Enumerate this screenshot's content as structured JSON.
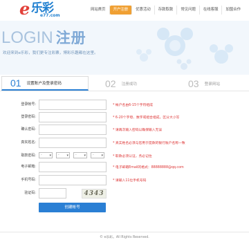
{
  "header": {
    "logo_mark": "e",
    "logo_cn": "乐彩",
    "logo_sub": "e77.com",
    "nav": [
      {
        "label": "网站首页",
        "active": false
      },
      {
        "label": "开户注册",
        "active": true
      },
      {
        "label": "优惠活动",
        "active": false
      },
      {
        "label": "存款取款",
        "active": false
      },
      {
        "label": "常见问题",
        "active": false
      },
      {
        "label": "在线客服",
        "active": false
      },
      {
        "label": "加盟合作",
        "active": false
      }
    ]
  },
  "banner": {
    "title_en": "LOGIN",
    "title_cn": "注册",
    "subtitle": "欢迎来到e乐彩，我们更专注彩票，博彩乐趣都在这里。"
  },
  "steps": [
    {
      "num": "01",
      "label": "设置账户及登录密码",
      "active": true
    },
    {
      "num": "02",
      "label": "注册成功",
      "active": false
    },
    {
      "num": "03",
      "label": "登录网站",
      "active": false
    }
  ],
  "form": {
    "fields": [
      {
        "label": "登录帐号:",
        "hint": "* 帐户名由6-15个字符组成"
      },
      {
        "label": "登录密码:",
        "hint": "* 6-20个字母、数字或组合组成，区分大小写"
      },
      {
        "label": "确认密码:",
        "hint": "* 请再次输入密码以确保输入无误"
      },
      {
        "label": "真实姓名:",
        "hint": "* 真实姓名必须与您用于提款的银行账户名称一致"
      },
      {
        "label": "取款密码:",
        "hint": "* 取款必须认证，务必记住"
      },
      {
        "label": "电子邮箱:",
        "hint": "* 电子邮箱Email的格式：88888888@qq.com"
      },
      {
        "label": "手机号码:",
        "hint": "* 请输入11位手机号码"
      },
      {
        "label": "验证码:",
        "hint": ""
      }
    ],
    "dob_options": [
      "-",
      "-",
      "-",
      "-"
    ],
    "captcha_text": "4343",
    "submit_label": "创建帐号"
  },
  "footer": {
    "copyright": "© e乐彩。All Rights Reserved."
  },
  "colors": {
    "accent": "#2a7fd4",
    "nav_active": "#f0a033",
    "hint": "#dd3333"
  }
}
